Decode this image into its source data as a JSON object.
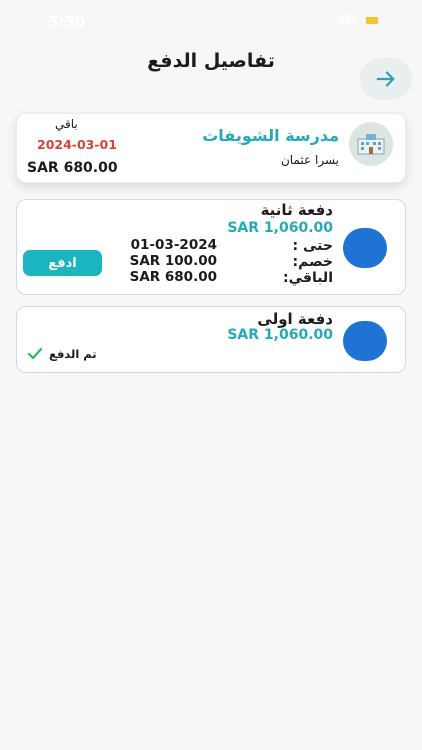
{
  "status_bar": {
    "time": "5:50",
    "signal": "4G"
  },
  "header": {
    "title": "تفاصيل الدفع"
  },
  "school": {
    "name": "مدرسة الشويفات",
    "student": "يسرا عثمان",
    "remaining_label": "باقي",
    "date": "2024-03-01",
    "amount": "SAR 680.00"
  },
  "payments": [
    {
      "title": "دفعة ثانية",
      "amount": "SAR 1,060.00",
      "due_label": "حتى :",
      "due_value": "01-03-2024",
      "discount_label": "خصم:",
      "discount_value": "SAR 100.00",
      "remaining_label": "الباقي:",
      "remaining_value": "SAR 680.00",
      "pay_button": "ادفع"
    },
    {
      "title": "دفعة اولى",
      "amount": "SAR 1,060.00",
      "paid_label": "تم الدفع"
    }
  ],
  "colors": {
    "accent": "#1bb5bf",
    "teal_text": "#25aab8",
    "alert": "#d9413a",
    "circle": "#1f73d4"
  }
}
